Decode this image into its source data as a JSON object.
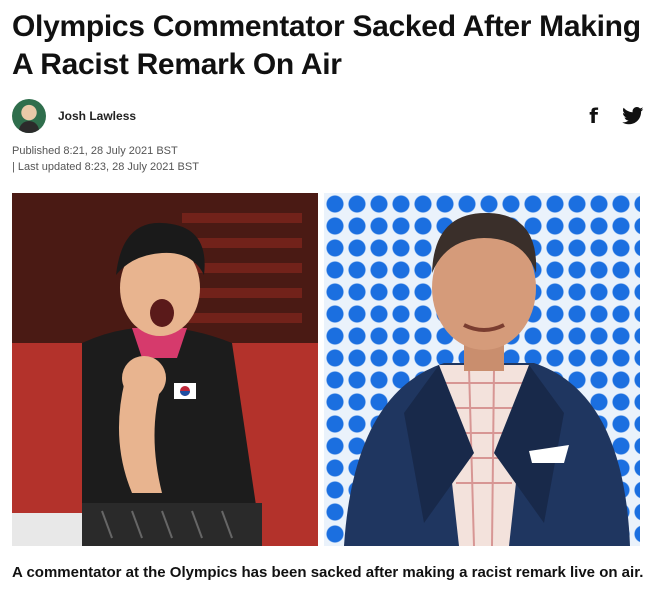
{
  "article": {
    "headline": "Olympics Commentator Sacked After Making A Racist Remark On Air",
    "author": "Josh Lawless",
    "published": "Published 8:21, 28 July 2021 BST",
    "updated": "| Last updated 8:23, 28 July 2021 BST",
    "caption": "A commentator at the Olympics has been sacked after making a racist remark live on air."
  },
  "social": {
    "facebook_glyph": "f",
    "facebook_icon": "facebook-icon",
    "twitter_icon": "twitter-icon"
  },
  "colors": {
    "text": "#111111",
    "meta": "#555555",
    "dots": "#1b6fe0"
  }
}
